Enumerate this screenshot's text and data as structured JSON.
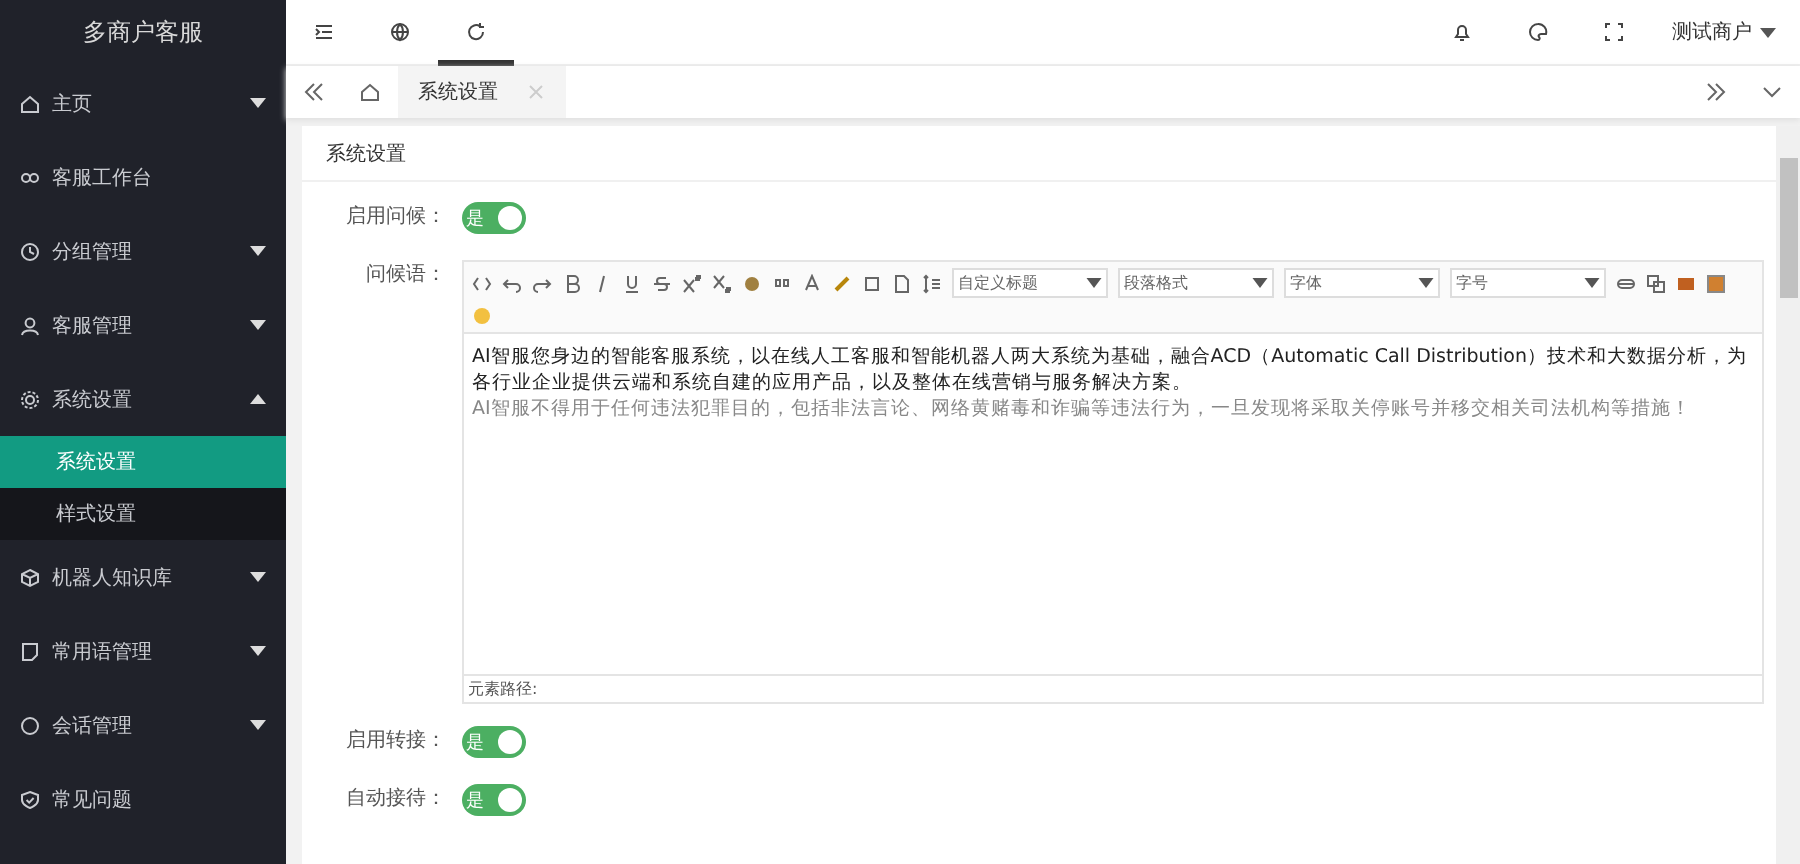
{
  "sidebar": {
    "title": "多商户客服",
    "items": [
      {
        "label": "主页",
        "kind": "group",
        "expanded": false
      },
      {
        "label": "客服工作台",
        "kind": "link"
      },
      {
        "label": "分组管理",
        "kind": "group",
        "expanded": false
      },
      {
        "label": "客服管理",
        "kind": "group",
        "expanded": false
      },
      {
        "label": "系统设置",
        "kind": "group",
        "expanded": true,
        "children": [
          {
            "label": "系统设置",
            "selected": true
          },
          {
            "label": "样式设置",
            "selected": false
          }
        ]
      },
      {
        "label": "机器人知识库",
        "kind": "group",
        "expanded": false
      },
      {
        "label": "常用语管理",
        "kind": "group",
        "expanded": false
      },
      {
        "label": "会话管理",
        "kind": "group",
        "expanded": false
      },
      {
        "label": "常见问题",
        "kind": "link"
      }
    ]
  },
  "topbar": {
    "user": "测试商户"
  },
  "tabs": [
    {
      "label": "系统设置",
      "selected": true
    }
  ],
  "panel": {
    "title": "系统设置",
    "fields": [
      {
        "kind": "toggle",
        "label": "启用问候：",
        "on": true,
        "text": "是"
      },
      {
        "kind": "editor",
        "label": "问候语：",
        "selects": [
          "自定义标题",
          "段落格式",
          "字体",
          "字号"
        ],
        "paragraphs": [
          {
            "kind": "main",
            "text": "AI智服您身边的智能客服系统，以在线人工客服和智能机器人两大系统为基础，融合ACD（Automatic Call Distribution）技术和大数据分析，为各行业企业提供云端和系统自建的应用产品，以及整体在线营销与服务解决方案。"
          },
          {
            "kind": "note",
            "text": "AI智服不得用于任何违法犯罪目的，包括非法言论、网络黄赌毒和诈骗等违法行为，一旦发现将采取关停账号并移交相关司法机构等措施！"
          }
        ],
        "path": "元素路径:"
      },
      {
        "kind": "toggle",
        "label": "启用转接：",
        "on": true,
        "text": "是"
      },
      {
        "kind": "toggle",
        "label": "自动接待：",
        "on": true,
        "text": "是"
      }
    ]
  }
}
